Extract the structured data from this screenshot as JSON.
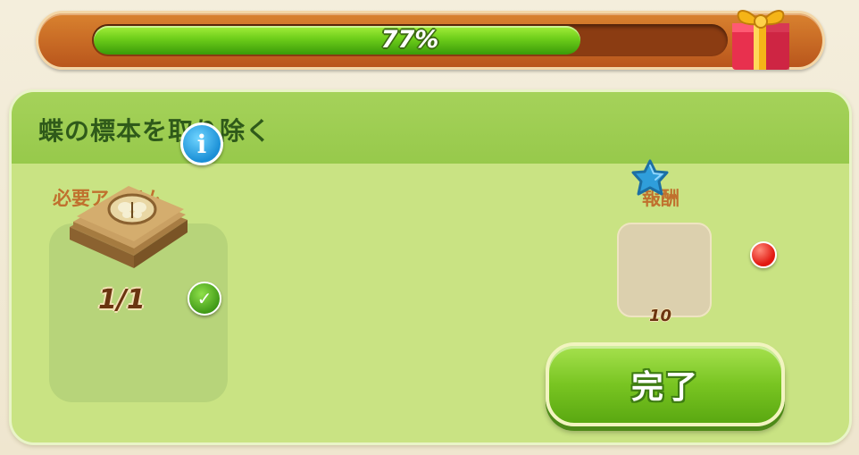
{
  "progress": {
    "percent": 77,
    "label": "77%"
  },
  "gift": {
    "icon": "gift-box-icon"
  },
  "task": {
    "title": "蝶の標本を取り除く",
    "required_items_label": "必要アイテム",
    "reward_label": "報酬",
    "required_item": {
      "icon": "butterfly-specimen-icon",
      "count": "1/1",
      "completed": true
    },
    "reward": {
      "icon": "blue-star-icon",
      "amount": "10"
    },
    "complete_button_label": "完了"
  },
  "colors": {
    "progress_fill": "#6dcd1a",
    "frame": "#c66a25",
    "panel": "#c9e383",
    "header": "#9fcf55",
    "button": "#79c522",
    "notification": "#e21a12"
  }
}
